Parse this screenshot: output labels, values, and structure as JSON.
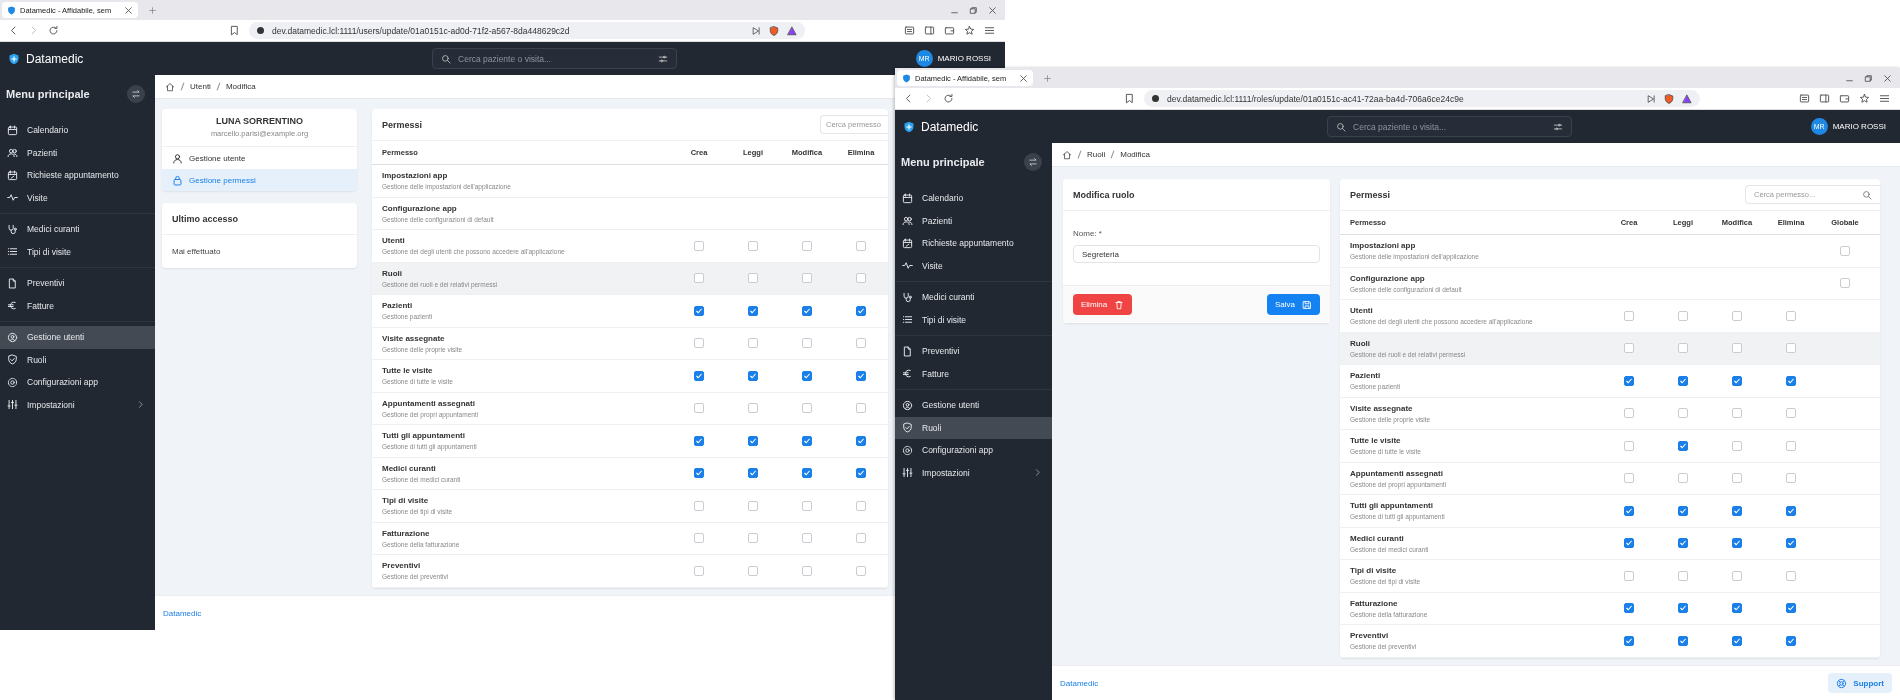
{
  "windows": [
    {
      "tab": {
        "title": "Datamedic - Affidabile, sem"
      },
      "url": "dev.datamedic.lcl:1111/users/update/01a0151c-ad0d-71f2-a567-8da448629c2d",
      "app": {
        "brand": "Datamedic",
        "search_placeholder": "Cerca paziente o visita...",
        "user": {
          "initials": "MR",
          "name": "MARIO ROSSI"
        }
      },
      "sidebar": {
        "title": "Menu principale",
        "groups": [
          [
            {
              "label": "Calendario",
              "selected": false
            },
            {
              "label": "Pazienti",
              "selected": false
            },
            {
              "label": "Richieste appuntamento",
              "selected": false
            },
            {
              "label": "Visite",
              "selected": false
            }
          ],
          [
            {
              "label": "Medici curanti",
              "selected": false
            },
            {
              "label": "Tipi di visite",
              "selected": false
            }
          ],
          [
            {
              "label": "Preventivi",
              "selected": false
            },
            {
              "label": "Fatture",
              "selected": false
            }
          ],
          [
            {
              "label": "Gestione utenti",
              "selected": true
            },
            {
              "label": "Ruoli",
              "selected": false
            },
            {
              "label": "Configurazioni app",
              "selected": false
            },
            {
              "label": "Impostazioni",
              "selected": false
            }
          ]
        ]
      },
      "breadcrumb": [
        "Utenti",
        "Modifica"
      ],
      "page": {
        "kind": "user",
        "profile": {
          "name": "LUNA SORRENTINO",
          "email": "marcello.parisi@example.org",
          "menu": [
            {
              "label": "Gestione utente",
              "selected": false
            },
            {
              "label": "Gestione permessi",
              "selected": true
            }
          ]
        },
        "last_access": {
          "title": "Ultimo accesso",
          "value": "Mai effettuato"
        },
        "permissions": {
          "title": "Permessi",
          "search_placeholder": "Cerca permesso",
          "columns": [
            "Permesso",
            "Crea",
            "Leggi",
            "Modifica",
            "Elimina"
          ],
          "rows": [
            {
              "name": "Impostazioni app",
              "description": "Gestione delle impostazioni dell'applicazione",
              "highlighted": false,
              "cells": [
                {
                  "kind": "none"
                },
                {
                  "kind": "none"
                },
                {
                  "kind": "none"
                },
                {
                  "kind": "none"
                }
              ]
            },
            {
              "name": "Configurazione app",
              "description": "Gestione delle configurazioni di default",
              "highlighted": false,
              "cells": [
                {
                  "kind": "none"
                },
                {
                  "kind": "none"
                },
                {
                  "kind": "none"
                },
                {
                  "kind": "none"
                }
              ]
            },
            {
              "name": "Utenti",
              "description": "Gestione dei degli utenti che possono accedere all'applicazione",
              "highlighted": false,
              "cells": [
                {
                  "kind": "box",
                  "checked": false
                },
                {
                  "kind": "box",
                  "checked": false
                },
                {
                  "kind": "box",
                  "checked": false
                },
                {
                  "kind": "box",
                  "checked": false
                }
              ]
            },
            {
              "name": "Ruoli",
              "description": "Gestione dei ruoli e dei relativi permessi",
              "highlighted": true,
              "cells": [
                {
                  "kind": "box",
                  "checked": false
                },
                {
                  "kind": "box",
                  "checked": false
                },
                {
                  "kind": "box",
                  "checked": false
                },
                {
                  "kind": "box",
                  "checked": false
                }
              ]
            },
            {
              "name": "Pazienti",
              "description": "Gestione pazienti",
              "highlighted": false,
              "cells": [
                {
                  "kind": "box",
                  "checked": true
                },
                {
                  "kind": "box",
                  "checked": true
                },
                {
                  "kind": "box",
                  "checked": true
                },
                {
                  "kind": "box",
                  "checked": true
                }
              ]
            },
            {
              "name": "Visite assegnate",
              "description": "Gestione delle proprie visite",
              "highlighted": false,
              "cells": [
                {
                  "kind": "box",
                  "checked": false
                },
                {
                  "kind": "box",
                  "checked": false
                },
                {
                  "kind": "box",
                  "checked": false
                },
                {
                  "kind": "box",
                  "checked": false
                }
              ]
            },
            {
              "name": "Tutte le visite",
              "description": "Gestione di tutte le visite",
              "highlighted": false,
              "cells": [
                {
                  "kind": "box",
                  "checked": true
                },
                {
                  "kind": "box",
                  "checked": true
                },
                {
                  "kind": "box",
                  "checked": true
                },
                {
                  "kind": "box",
                  "checked": true
                }
              ]
            },
            {
              "name": "Appuntamenti assegnati",
              "description": "Gestione dei propri appuntamenti",
              "highlighted": false,
              "cells": [
                {
                  "kind": "box",
                  "checked": false
                },
                {
                  "kind": "box",
                  "checked": false
                },
                {
                  "kind": "box",
                  "checked": false
                },
                {
                  "kind": "box",
                  "checked": false
                }
              ]
            },
            {
              "name": "Tutti gli appuntamenti",
              "description": "Gestione di tutti gli appuntamenti",
              "highlighted": false,
              "cells": [
                {
                  "kind": "box",
                  "checked": true
                },
                {
                  "kind": "box",
                  "checked": true
                },
                {
                  "kind": "box",
                  "checked": true
                },
                {
                  "kind": "box",
                  "checked": true
                }
              ]
            },
            {
              "name": "Medici curanti",
              "description": "Gestione dei medici curanti",
              "highlighted": false,
              "cells": [
                {
                  "kind": "box",
                  "checked": true
                },
                {
                  "kind": "box",
                  "checked": true
                },
                {
                  "kind": "box",
                  "checked": true
                },
                {
                  "kind": "box",
                  "checked": true
                }
              ]
            },
            {
              "name": "Tipi di visite",
              "description": "Gestione dei tipi di visite",
              "highlighted": false,
              "cells": [
                {
                  "kind": "box",
                  "checked": false
                },
                {
                  "kind": "box",
                  "checked": false
                },
                {
                  "kind": "box",
                  "checked": false
                },
                {
                  "kind": "box",
                  "checked": false
                }
              ]
            },
            {
              "name": "Fatturazione",
              "description": "Gestione della fatturazione",
              "highlighted": false,
              "cells": [
                {
                  "kind": "box",
                  "checked": false
                },
                {
                  "kind": "box",
                  "checked": false
                },
                {
                  "kind": "box",
                  "checked": false
                },
                {
                  "kind": "box",
                  "checked": false
                }
              ]
            },
            {
              "name": "Preventivi",
              "description": "Gestione dei preventivi",
              "highlighted": false,
              "cells": [
                {
                  "kind": "box",
                  "checked": false
                },
                {
                  "kind": "box",
                  "checked": false
                },
                {
                  "kind": "box",
                  "checked": false
                },
                {
                  "kind": "box",
                  "checked": false
                }
              ]
            }
          ]
        }
      },
      "footer": {
        "link": "Datamedic"
      }
    },
    {
      "tab": {
        "title": "Datamedic - Affidabile, sem"
      },
      "url": "dev.datamedic.lcl:1111/roles/update/01a0151c-ac41-72aa-ba4d-706a6ce24c9e",
      "app": {
        "brand": "Datamedic",
        "search_placeholder": "Cerca paziente o visita...",
        "user": {
          "initials": "MR",
          "name": "MARIO ROSSI"
        }
      },
      "sidebar": {
        "title": "Menu principale",
        "groups": [
          [
            {
              "label": "Calendario",
              "selected": false
            },
            {
              "label": "Pazienti",
              "selected": false
            },
            {
              "label": "Richieste appuntamento",
              "selected": false
            },
            {
              "label": "Visite",
              "selected": false
            }
          ],
          [
            {
              "label": "Medici curanti",
              "selected": false
            },
            {
              "label": "Tipi di visite",
              "selected": false
            }
          ],
          [
            {
              "label": "Preventivi",
              "selected": false
            },
            {
              "label": "Fatture",
              "selected": false
            }
          ],
          [
            {
              "label": "Gestione utenti",
              "selected": false
            },
            {
              "label": "Ruoli",
              "selected": true
            },
            {
              "label": "Configurazioni app",
              "selected": false
            },
            {
              "label": "Impostazioni",
              "selected": false
            }
          ]
        ]
      },
      "breadcrumb": [
        "Ruoli",
        "Modifica"
      ],
      "page": {
        "kind": "role",
        "role_form": {
          "title": "Modifica ruolo",
          "label": "Nome: *",
          "value": "Segreteria",
          "delete": "Elimina",
          "save": "Salva"
        },
        "permissions": {
          "title": "Permessi",
          "search_placeholder": "Cerca permesso...",
          "columns": [
            "Permesso",
            "Crea",
            "Leggi",
            "Modifica",
            "Elimina",
            "Globale"
          ],
          "rows": [
            {
              "name": "Impostazioni app",
              "description": "Gestione delle impostazioni dell'applicazione",
              "highlighted": false,
              "cells": [
                {
                  "kind": "none"
                },
                {
                  "kind": "none"
                },
                {
                  "kind": "none"
                },
                {
                  "kind": "none"
                },
                {
                  "kind": "box",
                  "checked": false
                }
              ]
            },
            {
              "name": "Configurazione app",
              "description": "Gestione delle configurazioni di default",
              "highlighted": false,
              "cells": [
                {
                  "kind": "none"
                },
                {
                  "kind": "none"
                },
                {
                  "kind": "none"
                },
                {
                  "kind": "none"
                },
                {
                  "kind": "box",
                  "checked": false
                }
              ]
            },
            {
              "name": "Utenti",
              "description": "Gestione dei degli utenti che possono accedere all'applicazione",
              "highlighted": false,
              "cells": [
                {
                  "kind": "box",
                  "checked": false
                },
                {
                  "kind": "box",
                  "checked": false
                },
                {
                  "kind": "box",
                  "checked": false
                },
                {
                  "kind": "box",
                  "checked": false
                },
                {
                  "kind": "none"
                }
              ]
            },
            {
              "name": "Ruoli",
              "description": "Gestione dei ruoli e dei relativi permessi",
              "highlighted": true,
              "cells": [
                {
                  "kind": "box",
                  "checked": false
                },
                {
                  "kind": "box",
                  "checked": false
                },
                {
                  "kind": "box",
                  "checked": false
                },
                {
                  "kind": "box",
                  "checked": false
                },
                {
                  "kind": "none"
                }
              ]
            },
            {
              "name": "Pazienti",
              "description": "Gestione pazienti",
              "highlighted": false,
              "cells": [
                {
                  "kind": "box",
                  "checked": true
                },
                {
                  "kind": "box",
                  "checked": true
                },
                {
                  "kind": "box",
                  "checked": true
                },
                {
                  "kind": "box",
                  "checked": true
                },
                {
                  "kind": "none"
                }
              ]
            },
            {
              "name": "Visite assegnate",
              "description": "Gestione delle proprie visite",
              "highlighted": false,
              "cells": [
                {
                  "kind": "box",
                  "checked": false
                },
                {
                  "kind": "box",
                  "checked": false
                },
                {
                  "kind": "box",
                  "checked": false
                },
                {
                  "kind": "box",
                  "checked": false
                },
                {
                  "kind": "none"
                }
              ]
            },
            {
              "name": "Tutte le visite",
              "description": "Gestione di tutte le visite",
              "highlighted": false,
              "cells": [
                {
                  "kind": "box",
                  "checked": false
                },
                {
                  "kind": "box",
                  "checked": true
                },
                {
                  "kind": "box",
                  "checked": false
                },
                {
                  "kind": "box",
                  "checked": false
                },
                {
                  "kind": "none"
                }
              ]
            },
            {
              "name": "Appuntamenti assegnati",
              "description": "Gestione dei propri appuntamenti",
              "highlighted": false,
              "cells": [
                {
                  "kind": "box",
                  "checked": false
                },
                {
                  "kind": "box",
                  "checked": false
                },
                {
                  "kind": "box",
                  "checked": false
                },
                {
                  "kind": "box",
                  "checked": false
                },
                {
                  "kind": "none"
                }
              ]
            },
            {
              "name": "Tutti gli appuntamenti",
              "description": "Gestione di tutti gli appuntamenti",
              "highlighted": false,
              "cells": [
                {
                  "kind": "box",
                  "checked": true
                },
                {
                  "kind": "box",
                  "checked": true
                },
                {
                  "kind": "box",
                  "checked": true
                },
                {
                  "kind": "box",
                  "checked": true
                },
                {
                  "kind": "none"
                }
              ]
            },
            {
              "name": "Medici curanti",
              "description": "Gestione dei medici curanti",
              "highlighted": false,
              "cells": [
                {
                  "kind": "box",
                  "checked": true
                },
                {
                  "kind": "box",
                  "checked": true
                },
                {
                  "kind": "box",
                  "checked": true
                },
                {
                  "kind": "box",
                  "checked": true
                },
                {
                  "kind": "none"
                }
              ]
            },
            {
              "name": "Tipi di visite",
              "description": "Gestione dei tipi di visite",
              "highlighted": false,
              "cells": [
                {
                  "kind": "box",
                  "checked": false
                },
                {
                  "kind": "box",
                  "checked": false
                },
                {
                  "kind": "box",
                  "checked": false
                },
                {
                  "kind": "box",
                  "checked": false
                },
                {
                  "kind": "none"
                }
              ]
            },
            {
              "name": "Fatturazione",
              "description": "Gestione della fatturazione",
              "highlighted": false,
              "cells": [
                {
                  "kind": "box",
                  "checked": true
                },
                {
                  "kind": "box",
                  "checked": true
                },
                {
                  "kind": "box",
                  "checked": true
                },
                {
                  "kind": "box",
                  "checked": true
                },
                {
                  "kind": "none"
                }
              ]
            },
            {
              "name": "Preventivi",
              "description": "Gestione dei preventivi",
              "highlighted": false,
              "cells": [
                {
                  "kind": "box",
                  "checked": true
                },
                {
                  "kind": "box",
                  "checked": true
                },
                {
                  "kind": "box",
                  "checked": true
                },
                {
                  "kind": "box",
                  "checked": true
                },
                {
                  "kind": "none"
                }
              ]
            }
          ]
        }
      },
      "footer": {
        "link": "Datamedic",
        "support": "Support"
      }
    }
  ]
}
